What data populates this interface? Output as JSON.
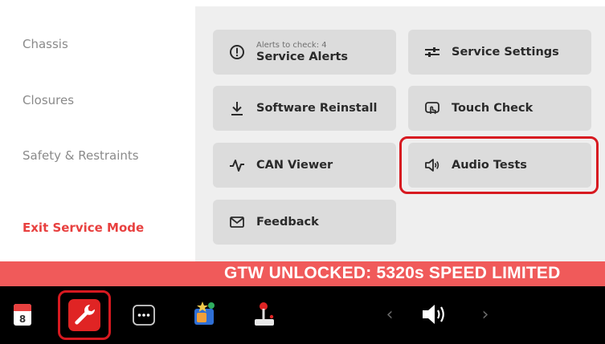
{
  "sidebar": {
    "items": [
      {
        "label": "Chassis"
      },
      {
        "label": "Closures"
      },
      {
        "label": "Safety & Restraints"
      }
    ],
    "exit_label": "Exit Service Mode"
  },
  "tiles": {
    "service_alerts": {
      "sub": "Alerts to check: 4",
      "label": "Service Alerts",
      "icon": "alert-circle-icon"
    },
    "service_settings": {
      "label": "Service Settings",
      "icon": "sliders-icon"
    },
    "software_reinstall": {
      "label": "Software Reinstall",
      "icon": "download-icon"
    },
    "touch_check": {
      "label": "Touch Check",
      "icon": "touch-icon"
    },
    "can_viewer": {
      "label": "CAN Viewer",
      "icon": "waveform-icon"
    },
    "audio_tests": {
      "label": "Audio Tests",
      "icon": "speaker-icon"
    },
    "feedback": {
      "label": "Feedback",
      "icon": "envelope-icon"
    }
  },
  "banner": {
    "text": "GTW UNLOCKED: 5320s   SPEED LIMITED"
  },
  "taskbar": {
    "calendar_day": "8",
    "nav_prev": "‹",
    "nav_next": "›"
  },
  "colors": {
    "accent_red": "#d71920",
    "banner_red": "#f05a5a",
    "tile_bg": "#dcdcdc",
    "panel_bg": "#efefef"
  }
}
